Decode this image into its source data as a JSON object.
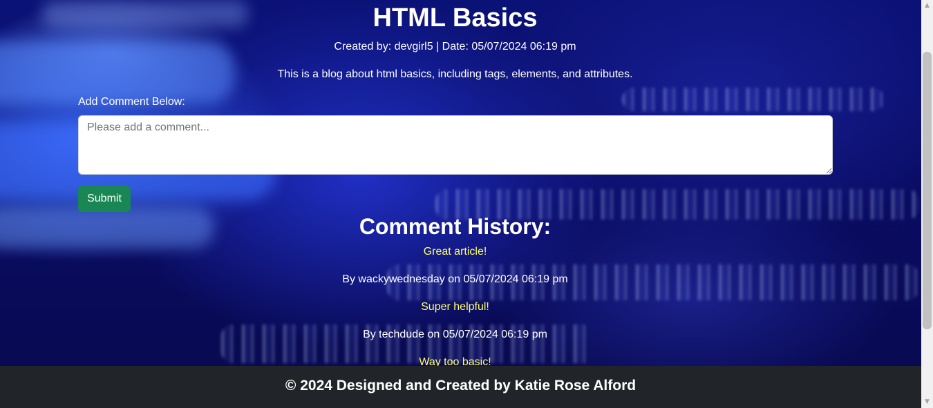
{
  "post": {
    "title": "HTML Basics",
    "meta": "Created by: devgirl5 | Date: 05/07/2024 06:19 pm",
    "description": "This is a blog about html basics, including tags, elements, and attributes."
  },
  "comment_form": {
    "label": "Add Comment Below:",
    "placeholder": "Please add a comment...",
    "value": "",
    "submit_label": "Submit"
  },
  "history": {
    "title": "Comment History:",
    "comments": [
      {
        "text": "Great article!",
        "by": "By wackywednesday on 05/07/2024 06:19 pm"
      },
      {
        "text": "Super helpful!",
        "by": "By techdude on 05/07/2024 06:19 pm"
      },
      {
        "text": "Way too basic!",
        "by": ""
      }
    ]
  },
  "footer": {
    "text": "© 2024 Designed and Created by Katie Rose Alford"
  },
  "colors": {
    "comment_text": "#ffff66",
    "submit_button": "#198754",
    "footer_bg": "#212529"
  },
  "icons": {
    "scroll_up": "triangle-up",
    "scroll_down": "triangle-down"
  }
}
